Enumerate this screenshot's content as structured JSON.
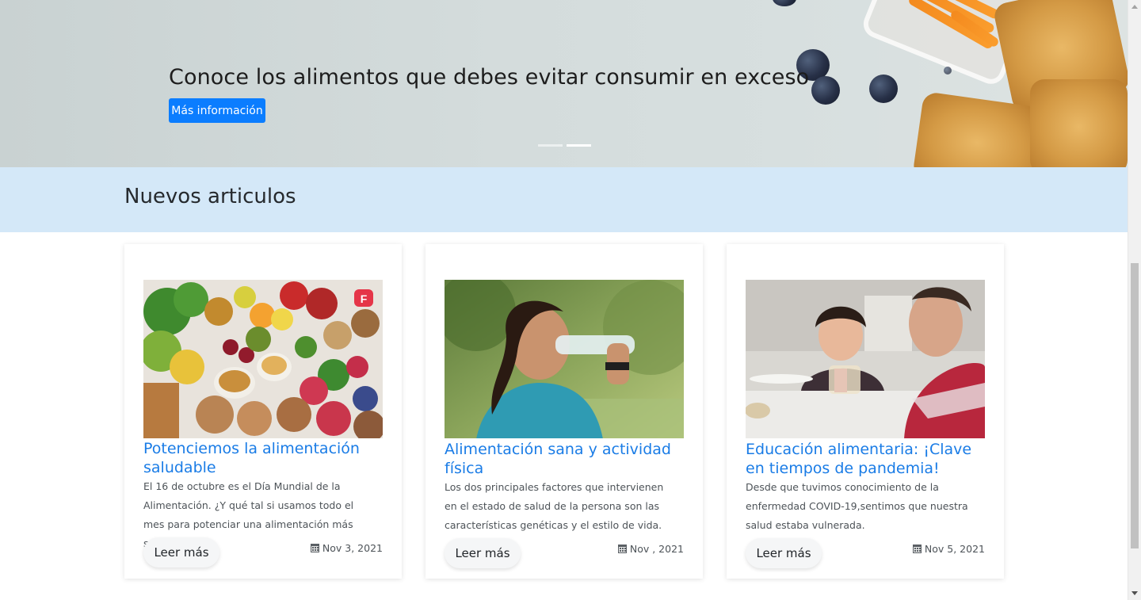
{
  "hero": {
    "title": "Conoce los alimentos que debes evitar consumir en exceso",
    "button_label": "Más información",
    "slides": 2,
    "active_slide": 2
  },
  "section": {
    "title": "Nuevos articulos"
  },
  "cards": [
    {
      "title": "Potenciemos la alimentación saludable",
      "text": "El 16 de octubre es el Día Mundial de la Alimentación. ¿Y qué tal si usamos todo el mes para potenciar una alimentación más saludable?",
      "button_label": "Leer más",
      "date": "Nov 3, 2021",
      "image": "assorted-healthy-foods-photo",
      "badge_letter": "F"
    },
    {
      "title": "Alimentación sana y actividad física",
      "text": "Los dos principales factores que intervienen en el estado de salud de la persona son las características genéticas y el estilo de vida.",
      "button_label": "Leer más",
      "date": "Nov , 2021",
      "image": "woman-drinking-water-photo"
    },
    {
      "title": "Educación alimentaria: ¡Clave en tiempos de pandemia!",
      "text": "Desde que tuvimos conocimiento de la enfermedad COVID-19,sentimos que nuestra salud estaba vulnerada.",
      "button_label": "Leer más",
      "date": "Nov 5, 2021",
      "image": "children-eating-photo"
    }
  ],
  "colors": {
    "accent": "#0b7dff",
    "title_link": "#1a7ce6",
    "band": "#d4e8f8"
  }
}
